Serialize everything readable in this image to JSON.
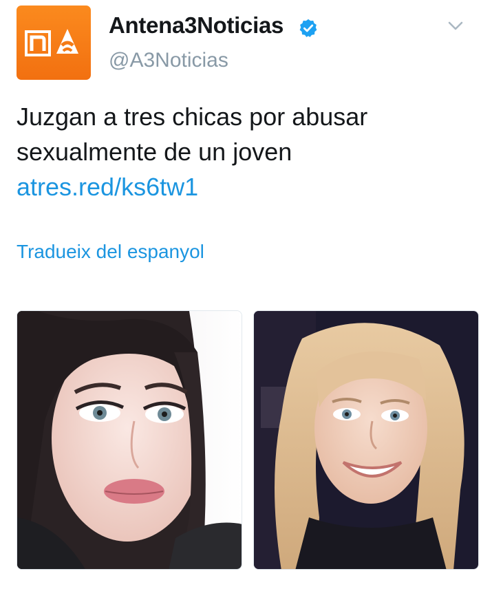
{
  "author": {
    "display_name": "Antena3Noticias",
    "handle": "@A3Noticias",
    "verified": true,
    "avatar_icon": "antena3-noticias-logo",
    "avatar_color": "#f47b16"
  },
  "tweet": {
    "text": "Juzgan a tres chicas por abusar sexualmente de un joven ",
    "link_text": "atres.red/ks6tw1",
    "link_color": "#1b95e0"
  },
  "translate_label": "Tradueix del espanyol",
  "media": [
    {
      "type": "photo",
      "description_icon": "portrait-photo"
    },
    {
      "type": "photo",
      "description_icon": "portrait-photo"
    }
  ],
  "menu_icon": "chevron-down-icon"
}
